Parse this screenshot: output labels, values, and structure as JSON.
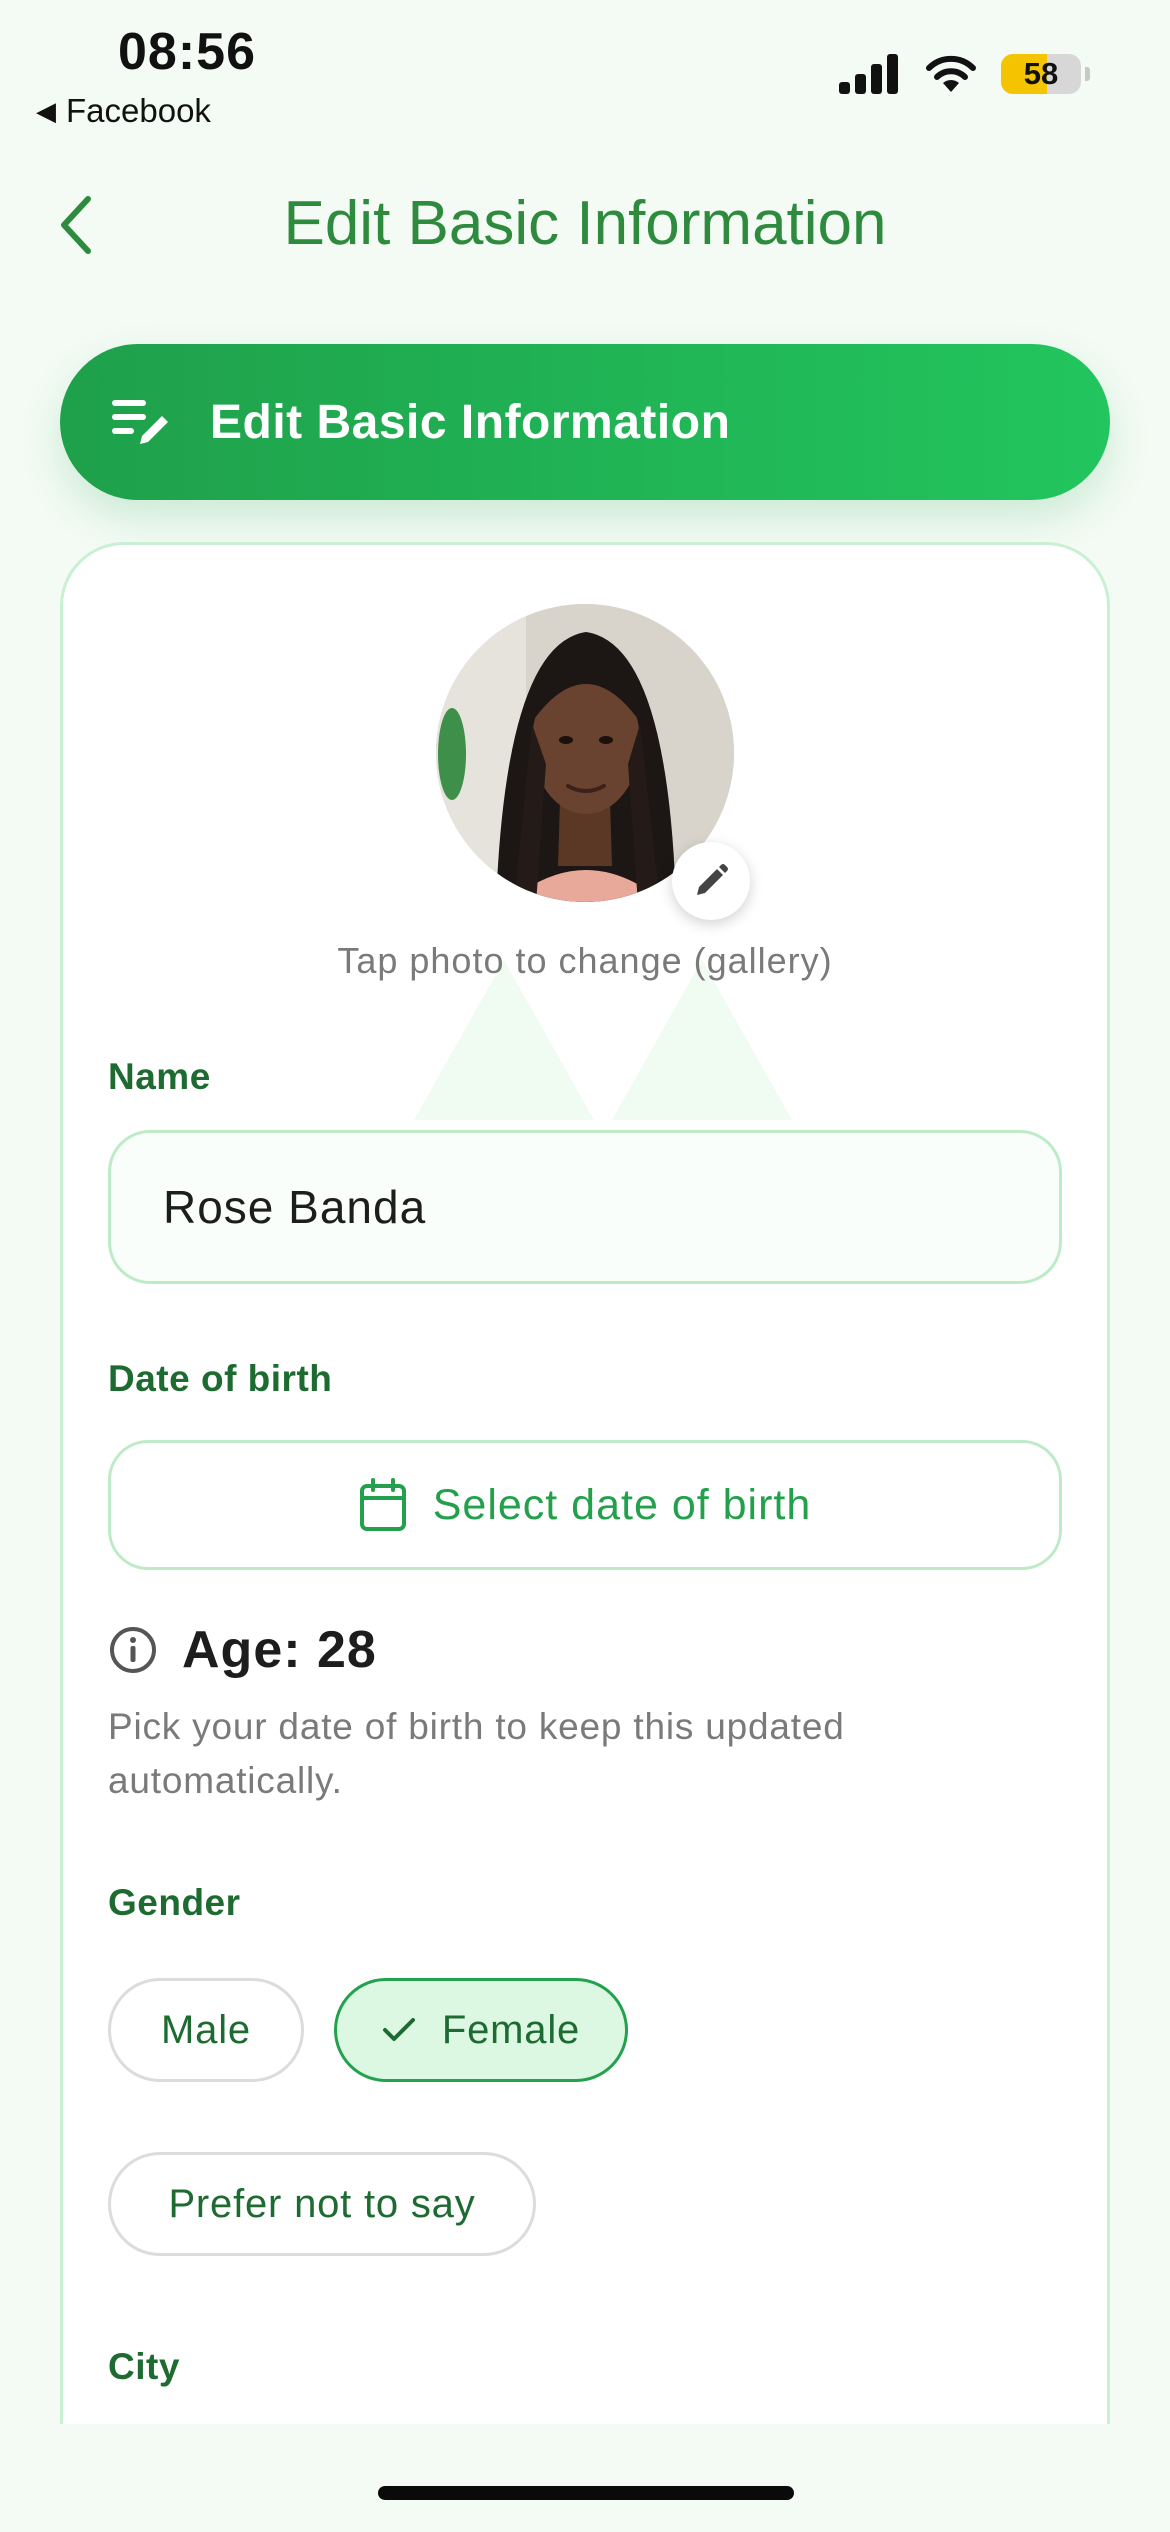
{
  "status_bar": {
    "time": "08:56",
    "back_app": "Facebook",
    "battery": "58",
    "icons": [
      "cellular-signal-icon",
      "wifi-icon",
      "battery-icon"
    ]
  },
  "nav": {
    "title": "Edit Basic Information",
    "back_icon": "chevron-left-icon"
  },
  "banner": {
    "title": "Edit Basic Information",
    "icon": "edit-note-icon"
  },
  "profile": {
    "photo_hint": "Tap photo to change (gallery)",
    "edit_icon": "pencil-icon"
  },
  "form": {
    "name": {
      "label": "Name",
      "value": "Rose Banda"
    },
    "dob": {
      "label": "Date of birth",
      "button": "Select date of birth",
      "icon": "calendar-icon"
    },
    "age": {
      "text": "Age: 28",
      "icon": "info-icon",
      "help": "Pick your date of birth to keep this updated automatically."
    },
    "gender": {
      "label": "Gender",
      "options": [
        "Male",
        "Female",
        "Prefer not to say"
      ],
      "selected": "Female"
    },
    "city": {
      "label": "City"
    }
  },
  "colors": {
    "primary": "#22a04b",
    "primary_dark": "#1e6b31",
    "title_green": "#2e8b3e",
    "background": "#f3fbf4",
    "chip_selected_bg": "#dcf8e3"
  }
}
